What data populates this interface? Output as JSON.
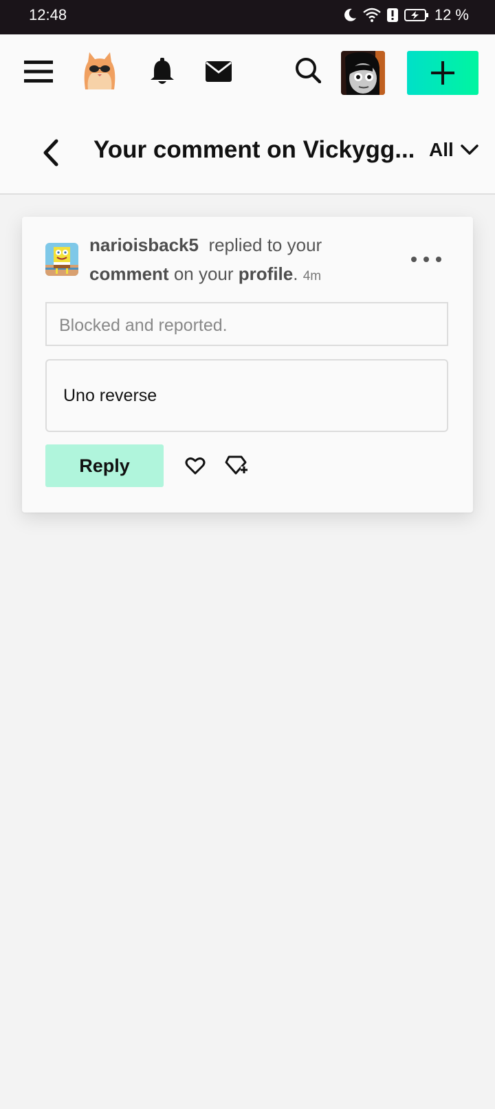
{
  "status_bar": {
    "time": "12:48",
    "battery_text": "12 %",
    "icons": [
      "moon-icon",
      "wifi-icon",
      "alert-icon",
      "battery-charging-icon"
    ]
  },
  "nav": {
    "icons": [
      "hamburger-menu-icon",
      "cat-logo",
      "bell-icon",
      "mail-icon",
      "search-icon",
      "user-avatar",
      "plus-icon"
    ],
    "accent_gradient": [
      "#00e0c8",
      "#00f5a0"
    ]
  },
  "header": {
    "title": "Your comment on Vickygg...",
    "filter_label": "All"
  },
  "notification": {
    "username": "narioisback5",
    "text_replied": "replied to your",
    "word_comment": "comment",
    "text_on_your": "on your",
    "word_profile": "profile",
    "period": ".",
    "time_ago": "4m",
    "quoted_text": "Blocked and reported.",
    "reply_text": "Uno reverse",
    "reply_button": "Reply",
    "reply_button_color": "#b0f5dc"
  }
}
